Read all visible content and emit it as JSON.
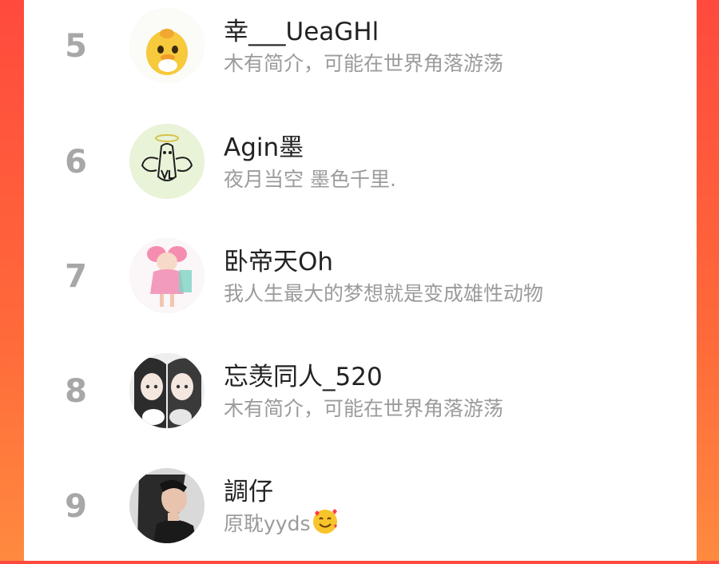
{
  "ranking": {
    "rows": [
      {
        "rank": "5",
        "name": "幸___UeaGHl",
        "bio": "木有简介，可能在世界角落游荡",
        "avatar": "yellow-duck-avatar"
      },
      {
        "rank": "6",
        "name": "Agin墨",
        "bio": "夜月当空 墨色千里.",
        "avatar": "green-sketch-avatar"
      },
      {
        "rank": "7",
        "name": "卧帝天Oh",
        "bio": "我人生最大的梦想就是变成雄性动物",
        "avatar": "pink-anime-girl-avatar"
      },
      {
        "rank": "8",
        "name": "忘羡同人_520",
        "bio": "木有简介，可能在世界角落游荡",
        "avatar": "two-anime-characters-avatar"
      },
      {
        "rank": "9",
        "name": "調仔",
        "bio": "原耽yyds",
        "avatar": "photo-portrait-avatar",
        "bio_emoji": "smiling-hearts-emoji"
      }
    ]
  },
  "colors": {
    "background_red": "#ff4a3d",
    "background_orange": "#ff8a3f",
    "rank_gray": "#a7a7a7",
    "name_text": "#222222",
    "bio_text": "#9b9b9b"
  }
}
